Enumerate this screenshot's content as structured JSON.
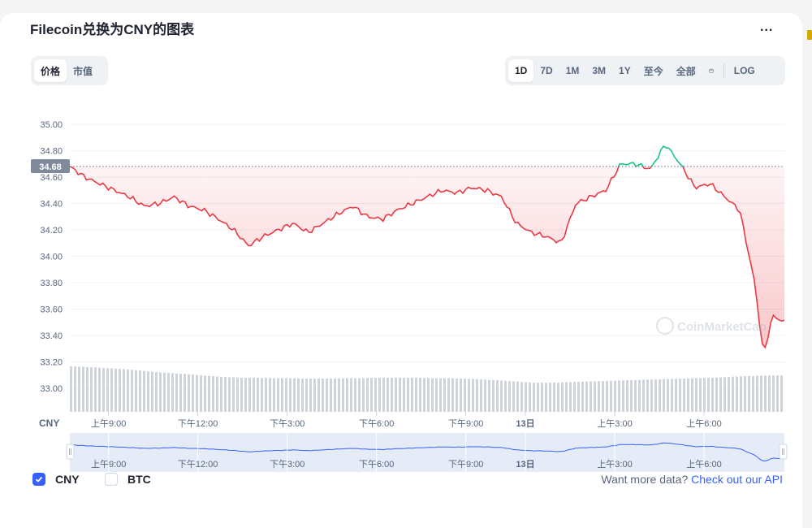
{
  "title": "Filecoin兑换为CNY的图表",
  "more_label": "...",
  "view_toggle": {
    "items": [
      "价格",
      "市值"
    ],
    "active": 0
  },
  "range_toggle": {
    "items": [
      "1D",
      "7D",
      "1M",
      "3M",
      "1Y",
      "至今",
      "全部"
    ],
    "active": 0,
    "log_label": "LOG"
  },
  "icons": {
    "calendar": "calendar-icon",
    "logo": "coinmarketcap-logo"
  },
  "watermark": "CoinMarketCap",
  "colors": {
    "up": "#16c784",
    "down": "#ea3943",
    "accent": "#3861fb",
    "volume": "#cfd3da",
    "navigator": "#e6ebf8"
  },
  "currency_label": "CNY",
  "chart_data": {
    "type": "line",
    "title": "Filecoin兑换为CNY的图表",
    "xlabel": "",
    "ylabel": "",
    "ylim": [
      33.0,
      35.0
    ],
    "yticks": [
      "35.00",
      "34.80",
      "34.60",
      "34.40",
      "34.20",
      "34.00",
      "33.80",
      "33.60",
      "33.40",
      "33.20",
      "33.00"
    ],
    "current_price": 34.68,
    "current_price_label": "34.68",
    "baseline": 34.68,
    "xticks": [
      "上午9:00",
      "下午12:00",
      "下午3:00",
      "下午6:00",
      "下午9:00",
      "13日",
      "上午3:00",
      "上午6:00"
    ],
    "navigator_ticks": [
      "上午9:00",
      "下午12:00",
      "下午3:00",
      "下午6:00",
      "下午9:00",
      "13日",
      "上午3:00",
      "上午6:00"
    ],
    "x_hours": [
      0,
      0.5,
      1,
      1.5,
      2,
      2.5,
      3,
      3.5,
      4,
      4.5,
      5,
      5.5,
      6,
      6.5,
      7,
      7.5,
      8,
      8.5,
      9,
      9.5,
      10,
      10.5,
      11,
      11.5,
      12,
      12.5,
      13,
      13.5,
      14,
      14.5,
      15,
      15.5,
      16,
      16.5,
      17,
      17.5,
      18,
      18.5,
      19,
      19.5,
      20,
      20.5,
      21,
      21.5,
      22,
      22.5,
      23,
      23.3,
      23.6,
      24
    ],
    "series": [
      {
        "values": [
          34.68,
          34.6,
          34.55,
          34.5,
          34.45,
          34.38,
          34.4,
          34.45,
          34.38,
          34.35,
          34.28,
          34.2,
          34.08,
          34.15,
          34.2,
          34.25,
          34.18,
          34.25,
          34.32,
          34.38,
          34.3,
          34.28,
          34.35,
          34.4,
          34.45,
          34.5,
          34.48,
          34.52,
          34.5,
          34.45,
          34.25,
          34.18,
          34.15,
          34.1,
          34.4,
          34.45,
          34.5,
          34.7,
          34.7,
          34.66,
          34.85,
          34.7,
          34.52,
          34.55,
          34.45,
          34.35,
          33.8,
          33.25,
          33.55,
          33.5
        ]
      }
    ],
    "volume": [
      1.0,
      0.99,
      0.97,
      0.95,
      0.93,
      0.9,
      0.87,
      0.85,
      0.83,
      0.8,
      0.78,
      0.76,
      0.75,
      0.75,
      0.74,
      0.74,
      0.73,
      0.73,
      0.73,
      0.74,
      0.74,
      0.75,
      0.75,
      0.75,
      0.75,
      0.74,
      0.74,
      0.73,
      0.72,
      0.7,
      0.68,
      0.66,
      0.64,
      0.64,
      0.65,
      0.66,
      0.67,
      0.68,
      0.69,
      0.7,
      0.71,
      0.72,
      0.73,
      0.74,
      0.75,
      0.76,
      0.78,
      0.79,
      0.8,
      0.8
    ]
  },
  "legend": {
    "items": [
      {
        "label": "CNY",
        "checked": true
      },
      {
        "label": "BTC",
        "checked": false
      }
    ]
  },
  "api": {
    "prefix": "Want more data?",
    "link": "Check out our API"
  }
}
